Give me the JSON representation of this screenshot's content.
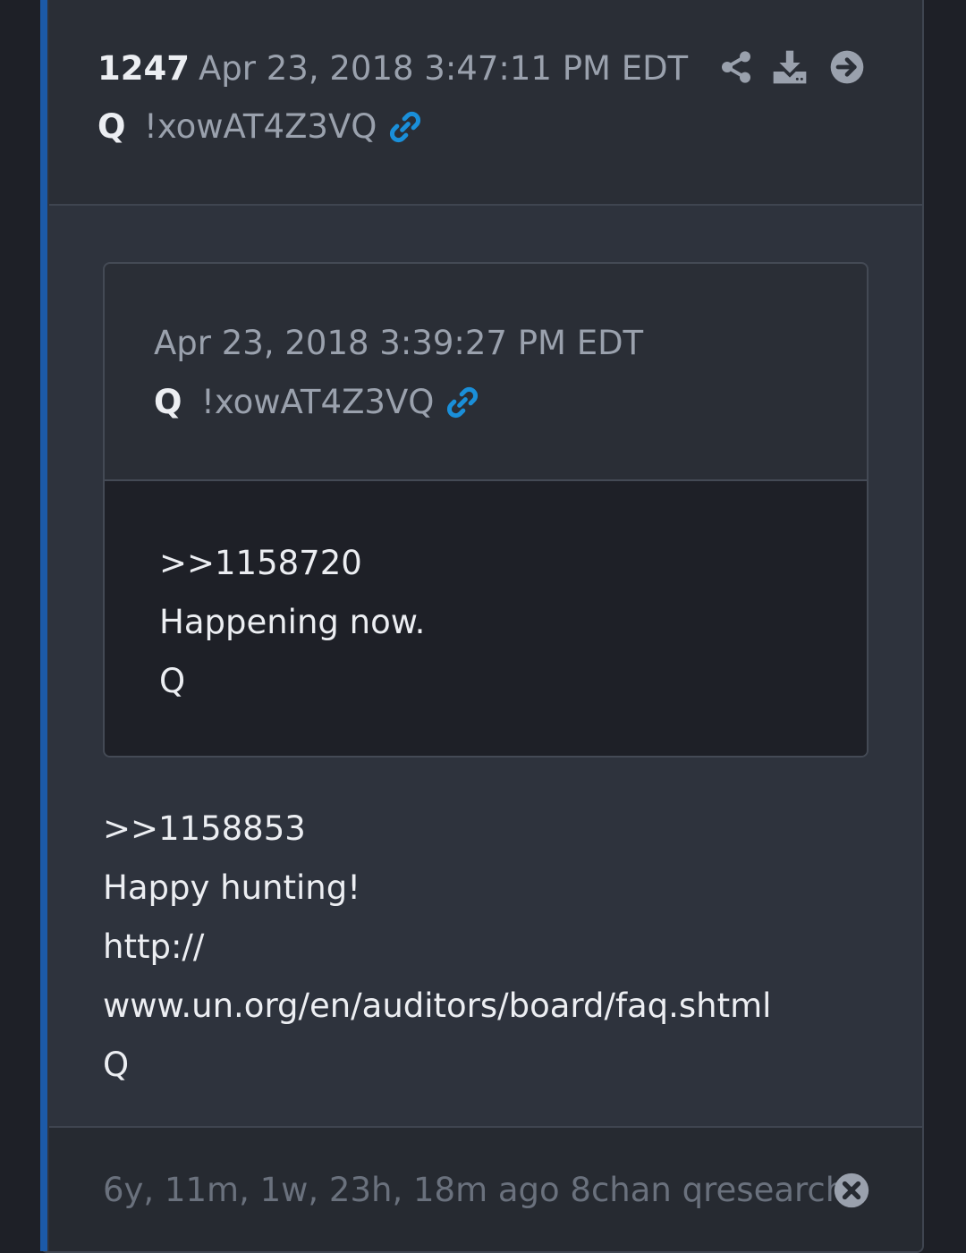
{
  "post": {
    "number": "1247",
    "timestamp": "Apr 23, 2018 3:47:11 PM EDT",
    "author": "Q",
    "tripcode": "!xowAT4Z3VQ",
    "icons": [
      "share-icon",
      "download-icon",
      "arrow-right-circle-icon",
      "link-icon"
    ]
  },
  "quoted": {
    "timestamp": "Apr 23, 2018 3:39:27 PM EDT",
    "author": "Q",
    "tripcode": "!xowAT4Z3VQ",
    "lines": [
      ">>1158720",
      "Happening now.",
      "Q"
    ]
  },
  "message": {
    "lines": [
      ">>1158853",
      "Happy hunting!",
      "http://",
      "www.un.org/en/auditors/board/faq.shtml",
      "Q"
    ]
  },
  "footer": {
    "text": "6y, 11m, 1w, 23h, 18m ago 8chan qresearch"
  },
  "colors": {
    "accent": "#1c5aa8",
    "link": "#1a8fd9"
  }
}
